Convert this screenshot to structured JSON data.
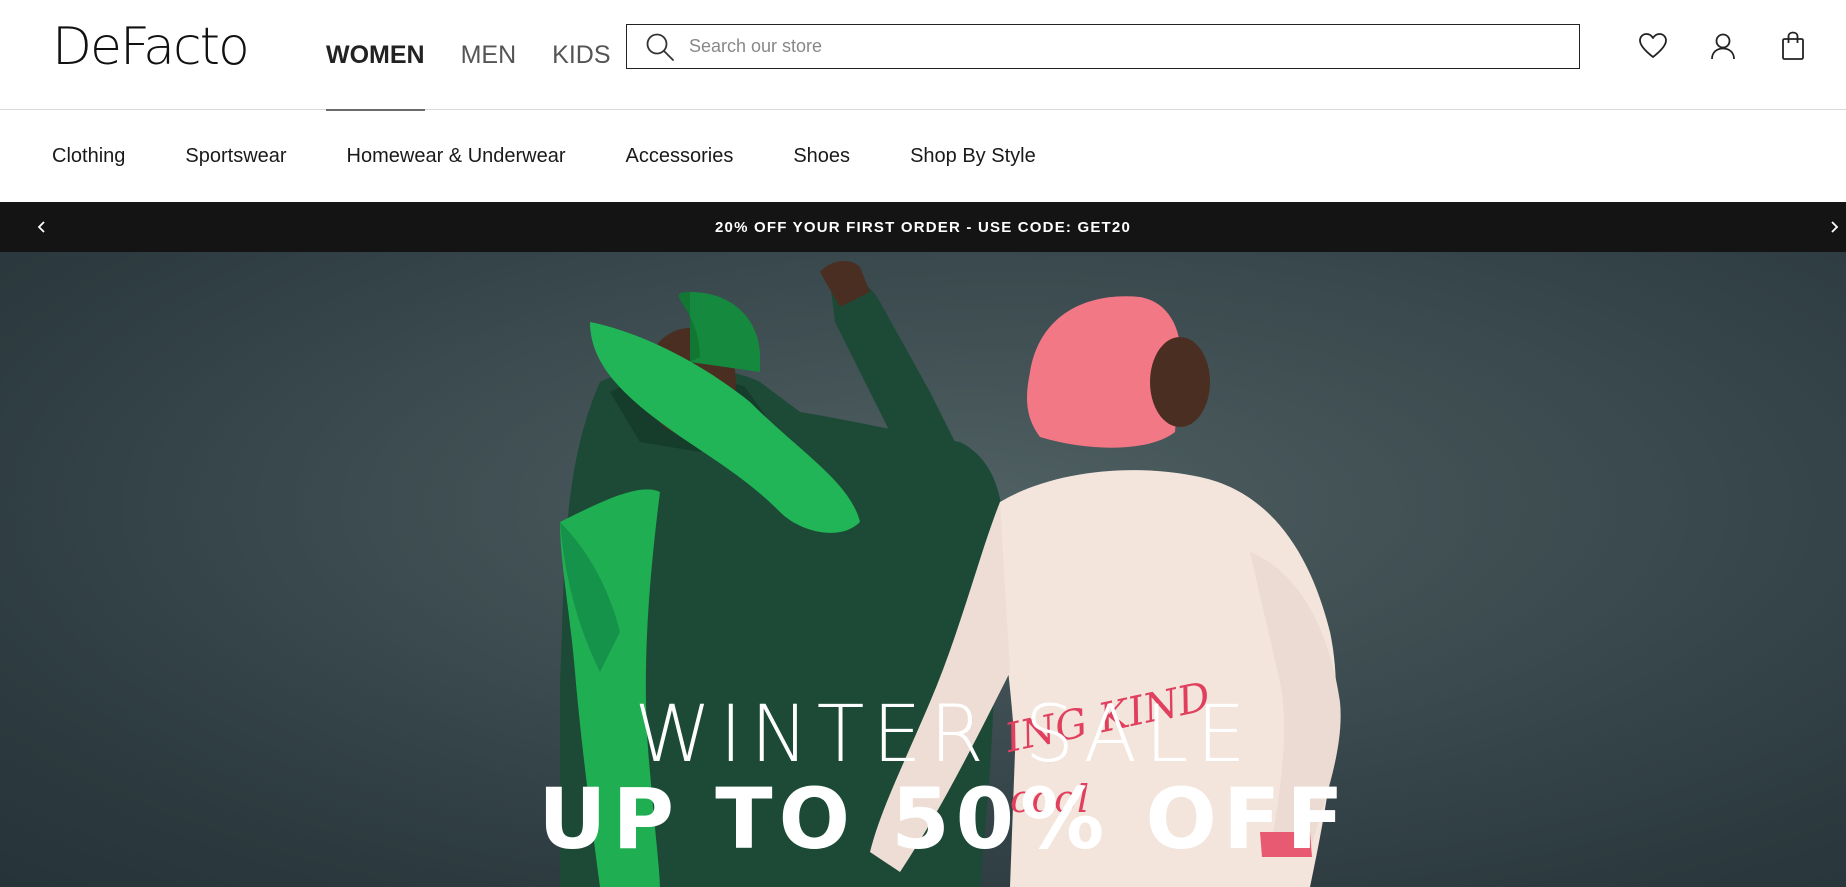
{
  "brand": {
    "logo_text": "DeFacto"
  },
  "gender_nav": [
    {
      "label": "WOMEN",
      "active": true
    },
    {
      "label": "MEN",
      "active": false
    },
    {
      "label": "KIDS",
      "active": false
    }
  ],
  "search": {
    "placeholder": "Search our store",
    "value": ""
  },
  "header_icons": [
    "heart-icon",
    "user-icon",
    "shopping-bag-icon"
  ],
  "categories": [
    {
      "label": "Clothing"
    },
    {
      "label": "Sportswear"
    },
    {
      "label": "Homewear & Underwear"
    },
    {
      "label": "Accessories"
    },
    {
      "label": "Shoes"
    },
    {
      "label": "Shop By Style"
    }
  ],
  "promo": {
    "text": "20% OFF YOUR FIRST ORDER - USE CODE: GET20",
    "prev_icon": "chevron-left-icon",
    "next_icon": "chevron-right-icon"
  },
  "hero": {
    "line1": "WINTER SALE",
    "line2": "UP TO 50% OFF",
    "sweatshirt_text_1": "ING KIND",
    "sweatshirt_text_2": "cool"
  },
  "colors": {
    "promo_bg": "#141414",
    "hero_bg": "#3a4a4e",
    "accent_green": "#12a84e",
    "hoodie_pink": "#f07a84"
  }
}
